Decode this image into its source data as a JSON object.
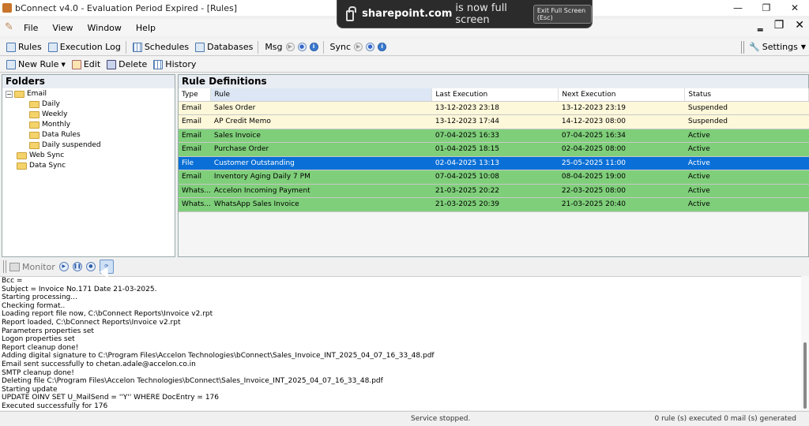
{
  "window": {
    "title": "bConnect v4.0 - Evaluation Period Expired - [Rules]",
    "minimize": "—",
    "maximize": "❐",
    "close": "✕"
  },
  "fullscreen_notice": {
    "domain": "sharepoint.com",
    "message": "is now full screen",
    "exit_label": "Exit Full Screen (Esc)"
  },
  "menu": {
    "items": [
      "File",
      "View",
      "Window",
      "Help"
    ]
  },
  "mdi": {
    "minimize": "‗",
    "restore": "❐",
    "close": "✕"
  },
  "toolbar": {
    "rules": "Rules",
    "execution_log": "Execution Log",
    "schedules": "Schedules",
    "databases": "Databases",
    "msg": "Msg",
    "sync": "Sync",
    "settings": "Settings"
  },
  "rule_toolbar": {
    "new_rule": "New Rule",
    "edit": "Edit",
    "delete": "Delete",
    "history": "History"
  },
  "folders": {
    "title": "Folders",
    "tree": [
      {
        "label": "Email",
        "expander": "−"
      },
      {
        "label": "Daily"
      },
      {
        "label": "Weekly"
      },
      {
        "label": "Monthly"
      },
      {
        "label": "Data Rules"
      },
      {
        "label": "Daily suspended"
      },
      {
        "label": "Web Sync"
      },
      {
        "label": "Data Sync"
      }
    ]
  },
  "rules_panel": {
    "title": "Rule Definitions",
    "columns": [
      "Type",
      "Rule",
      "Last Execution",
      "Next Execution",
      "Status"
    ],
    "rows": [
      {
        "type": "Email",
        "rule": "Sales Order",
        "last": "13-12-2023 23:18",
        "next": "13-12-2023 23:19",
        "status": "Suspended"
      },
      {
        "type": "Email",
        "rule": "AP Credit Memo",
        "last": "13-12-2023 17:44",
        "next": "14-12-2023 08:00",
        "status": "Suspended"
      },
      {
        "type": "Email",
        "rule": "Sales Invoice",
        "last": "07-04-2025 16:33",
        "next": "07-04-2025 16:34",
        "status": "Active"
      },
      {
        "type": "Email",
        "rule": "Purchase Order",
        "last": "01-04-2025 18:15",
        "next": "02-04-2025 08:00",
        "status": "Active"
      },
      {
        "type": "File",
        "rule": "Customer Outstanding",
        "last": "02-04-2025 13:13",
        "next": "25-05-2025 11:00",
        "status": "Active"
      },
      {
        "type": "Email",
        "rule": "Inventory Aging Daily 7 PM",
        "last": "07-04-2025 10:08",
        "next": "08-04-2025 19:00",
        "status": "Active"
      },
      {
        "type": "Whats...",
        "rule": "Accelon Incoming Payment",
        "last": "21-03-2025 20:22",
        "next": "22-03-2025 08:00",
        "status": "Active"
      },
      {
        "type": "Whats...",
        "rule": "WhatsApp Sales Invoice",
        "last": "21-03-2025 20:39",
        "next": "21-03-2025 20:40",
        "status": "Active"
      }
    ]
  },
  "monitor": {
    "label": "Monitor"
  },
  "log": [
    "Bcc =",
    "Subject = Invoice No.171 Date 21-03-2025.",
    "Starting processing...",
    "Checking format..",
    "Loading report file now, C:\\bConnect Reports\\Invoice v2.rpt",
    "Report loaded, C:\\bConnect Reports\\Invoice v2.rpt",
    "Parameters properties set",
    "Logon properties set",
    "Report cleanup done!",
    "Adding digital signature to C:\\Program Files\\Accelon Technologies\\bConnect\\Sales_Invoice_INT_2025_04_07_16_33_48.pdf",
    "Email sent successfully to chetan.adale@accelon.co.in",
    "SMTP cleanup done!",
    "Deleting file C:\\Program Files\\Accelon Technologies\\bConnect\\Sales_Invoice_INT_2025_04_07_16_33_48.pdf",
    "Starting update",
    "UPDATE OINV SET U_MailSend = ''Y'' WHERE DocEntry = 176",
    "Executed successfully for 176"
  ],
  "status": {
    "service": "Service stopped.",
    "counts": "0 rule (s) executed  0 mail (s) generated"
  }
}
